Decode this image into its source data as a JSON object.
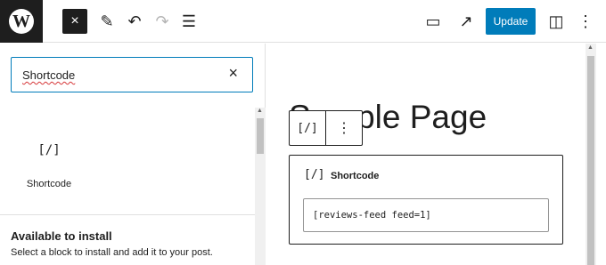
{
  "toolbar": {
    "logo_glyph": "W",
    "close_icon": "×",
    "pencil_icon": "✎",
    "undo_icon": "↶",
    "redo_icon": "↷",
    "list_icon": "☰",
    "preview_icon": "▭",
    "view_post_icon": "↗",
    "update_label": "Update",
    "settings_icon": "◫",
    "options_icon": "⋮"
  },
  "inserter": {
    "search_value": "Shortcode",
    "clear_icon": "×",
    "results": [
      {
        "icon": "[/]",
        "label": "Shortcode"
      }
    ],
    "install_title": "Available to install",
    "install_description": "Select a block to install and add it to your post."
  },
  "editor": {
    "page_title": "Sample Page",
    "block_toolbar": {
      "block_icon": "[/]",
      "more_icon": "⋮"
    },
    "shortcode_block": {
      "icon": "[/]",
      "label": "Shortcode",
      "value": "[reviews-feed feed=1]"
    }
  },
  "colors": {
    "accent": "#007cba",
    "dark": "#1e1e1e",
    "border": "#e0e0e0"
  }
}
